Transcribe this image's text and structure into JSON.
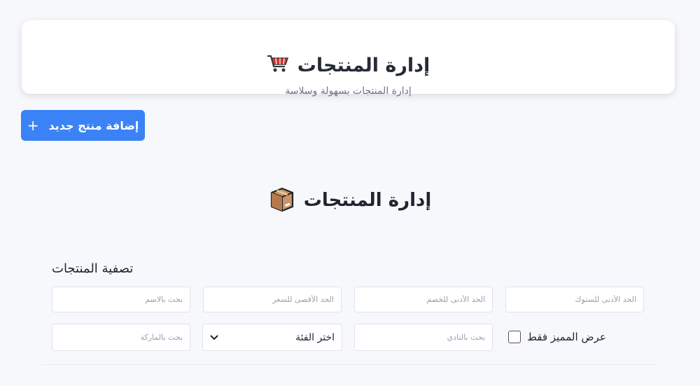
{
  "header": {
    "title": "إدارة المنتجات",
    "subtitle": "إدارة المنتجات بسهولة وسلاسة",
    "icon": "shopping-cart-icon"
  },
  "actions": {
    "add_label": "إضافة منتج جديد",
    "add_icon": "+"
  },
  "section": {
    "title": "إدارة المنتجات",
    "icon": "package-box-icon"
  },
  "filters": {
    "title": "تصفية المنتجات",
    "name_placeholder": "بحث بالاسم",
    "max_price_placeholder": "الحد الأقصى للسعر",
    "min_discount_placeholder": "الحد الأدنى للخصم",
    "min_stock_placeholder": "الحد الأدنى للستوك",
    "brand_placeholder": "بحث بالماركة",
    "category_selected": "اختر الفئة",
    "club_placeholder": "بحث بالنادي",
    "featured_label": "عرض المميز فقط"
  },
  "colors": {
    "accent": "#3b82f6",
    "background": "#f7f8fc"
  }
}
